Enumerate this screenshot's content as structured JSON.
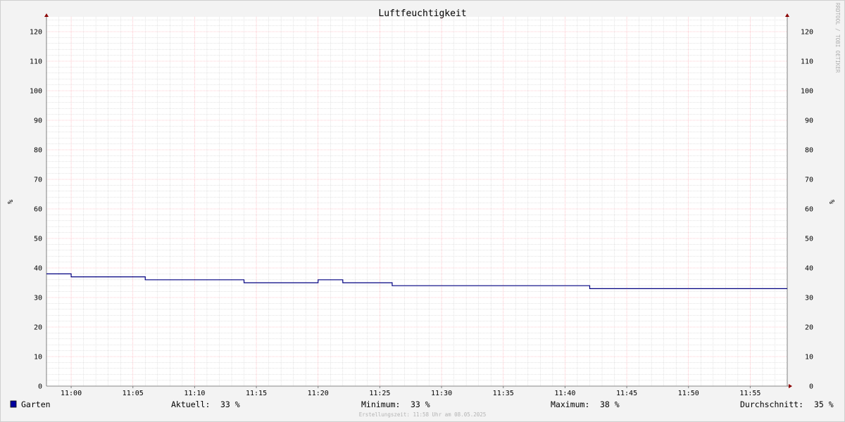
{
  "chart_data": {
    "type": "line",
    "title": "Luftfeuchtigkeit",
    "ylabel_left": "%",
    "ylabel_right": "%",
    "ylim": [
      0,
      125
    ],
    "y_ticks": [
      0,
      10,
      20,
      30,
      40,
      50,
      60,
      70,
      80,
      90,
      100,
      110,
      120
    ],
    "x_range_minutes": [
      658,
      718
    ],
    "x_ticks": [
      {
        "label": "11:00",
        "minutes": 660
      },
      {
        "label": "11:05",
        "minutes": 665
      },
      {
        "label": "11:10",
        "minutes": 670
      },
      {
        "label": "11:15",
        "minutes": 675
      },
      {
        "label": "11:20",
        "minutes": 680
      },
      {
        "label": "11:25",
        "minutes": 685
      },
      {
        "label": "11:30",
        "minutes": 690
      },
      {
        "label": "11:35",
        "minutes": 695
      },
      {
        "label": "11:40",
        "minutes": 700
      },
      {
        "label": "11:45",
        "minutes": 705
      },
      {
        "label": "11:50",
        "minutes": 710
      },
      {
        "label": "11:55",
        "minutes": 715
      }
    ],
    "grid": true,
    "series": [
      {
        "name": "Garten",
        "color": "#000080",
        "step_points": [
          {
            "t": "10:58",
            "y": 38
          },
          {
            "t": "11:00",
            "y": 37
          },
          {
            "t": "11:06",
            "y": 36
          },
          {
            "t": "11:14",
            "y": 35
          },
          {
            "t": "11:20",
            "y": 36
          },
          {
            "t": "11:22",
            "y": 35
          },
          {
            "t": "11:26",
            "y": 34
          },
          {
            "t": "11:42",
            "y": 33
          },
          {
            "t": "11:58",
            "y": 33
          }
        ]
      }
    ]
  },
  "legend": {
    "series_name": "Garten",
    "swatch_color": "#0000a0",
    "current_label": "Aktuell:",
    "current_value": "33 %",
    "min_label": "Minimum:",
    "min_value": "33 %",
    "max_label": "Maximum:",
    "max_value": "38 %",
    "avg_label": "Durchschnitt:",
    "avg_value": "35 %"
  },
  "footer": "Erstellungszeit: 11:58 Uhr am 08.05.2025",
  "watermark": "RRDTOOL / TOBI OETIKER",
  "colors": {
    "background": "#f3f3f3",
    "plot_background": "#ffffff",
    "major_grid": "#ff9da8",
    "minor_grid": "#c8c8c8",
    "axis": "#808080",
    "arrow": "#8b0000",
    "line": "#000080"
  }
}
